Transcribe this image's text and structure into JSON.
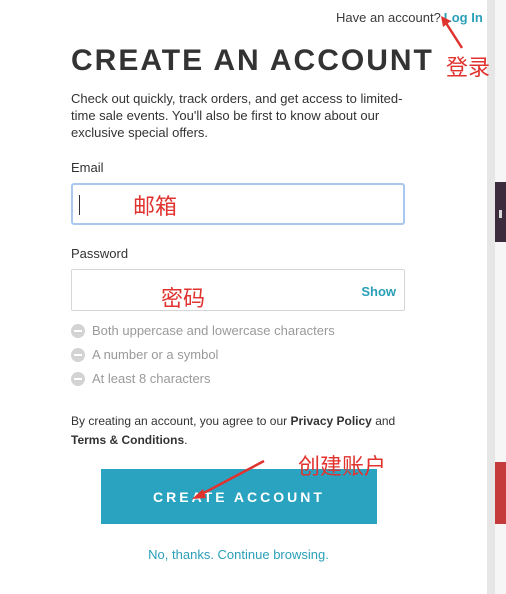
{
  "header": {
    "have_account_text": "Have an account?",
    "login_link": "Log In"
  },
  "title": "CREATE AN ACCOUNT",
  "intro": "Check out quickly, track orders, and get access to limited-time sale events. You'll also be first to know about our exclusive special offers.",
  "form": {
    "email_label": "Email",
    "email_value": "",
    "password_label": "Password",
    "password_value": "",
    "show_label": "Show"
  },
  "password_rules": [
    "Both uppercase and lowercase characters",
    "A number or a symbol",
    "At least 8 characters"
  ],
  "terms": {
    "prefix": "By creating an account, you agree to our ",
    "privacy": "Privacy Policy",
    "and": " and",
    "conditions": "Terms & Conditions",
    "suffix": "."
  },
  "create_button": "CREATE ACCOUNT",
  "continue_link": "No, thanks. Continue browsing.",
  "annotations": {
    "email": "邮箱",
    "password": "密码",
    "login": "登录",
    "create": "创建账户"
  },
  "colors": {
    "accent": "#2aa3c1",
    "link": "#2a9fb8",
    "annotation": "#e0332f",
    "focus_border": "#a8c8ef"
  }
}
